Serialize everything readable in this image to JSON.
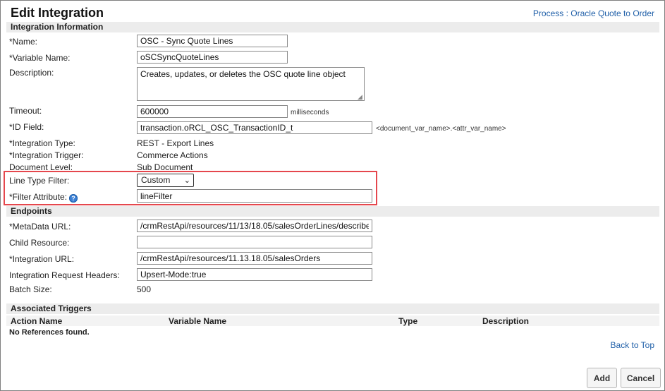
{
  "header": {
    "title": "Edit Integration",
    "process_link": "Process : Oracle Quote to Order"
  },
  "sections": {
    "integration_info": "Integration Information",
    "endpoints": "Endpoints",
    "associated_triggers": "Associated Triggers"
  },
  "fields": {
    "name": {
      "label": "*Name:",
      "value": "OSC - Sync Quote Lines"
    },
    "variable_name": {
      "label": "*Variable Name:",
      "value": "oSCSyncQuoteLines"
    },
    "description": {
      "label": "Description:",
      "value": "Creates, updates, or deletes the OSC quote line object"
    },
    "timeout": {
      "label": "Timeout:",
      "value": "600000",
      "unit": "milliseconds"
    },
    "id_field": {
      "label": "*ID Field:",
      "value": "transaction.oRCL_OSC_TransactionID_t",
      "hint": "<document_var_name>.<attr_var_name>"
    },
    "integration_type": {
      "label": "*Integration Type:",
      "value": "REST - Export Lines"
    },
    "integration_trigger": {
      "label": "*Integration Trigger:",
      "value": "Commerce Actions"
    },
    "document_level": {
      "label": "Document Level:",
      "value": "Sub Document"
    },
    "line_type_filter": {
      "label": "Line Type Filter:",
      "selected": "Custom"
    },
    "filter_attribute": {
      "label": "*Filter Attribute:",
      "value": "lineFilter"
    },
    "metadata_url": {
      "label": "*MetaData URL:",
      "value": "/crmRestApi/resources/11/13/18.05/salesOrderLines/describe"
    },
    "child_resource": {
      "label": "Child Resource:",
      "value": ""
    },
    "integration_url": {
      "label": "*Integration URL:",
      "value": "/crmRestApi/resources/11.13.18.05/salesOrders"
    },
    "request_headers": {
      "label": "Integration Request Headers:",
      "value": "Upsert-Mode:true"
    },
    "batch_size": {
      "label": "Batch Size:",
      "value": "500"
    }
  },
  "triggers_table": {
    "columns": [
      "Action Name",
      "Variable Name",
      "Type",
      "Description"
    ],
    "empty_text": "No References found."
  },
  "footer": {
    "back_to_top": "Back to Top",
    "add_label": "Add",
    "cancel_label": "Cancel"
  },
  "colors": {
    "link": "#1f5fa8",
    "highlight": "#e5474d",
    "section_bg": "#ececec"
  },
  "icons": {
    "help": "help-circle-icon",
    "dropdown": "chevron-down-icon"
  }
}
